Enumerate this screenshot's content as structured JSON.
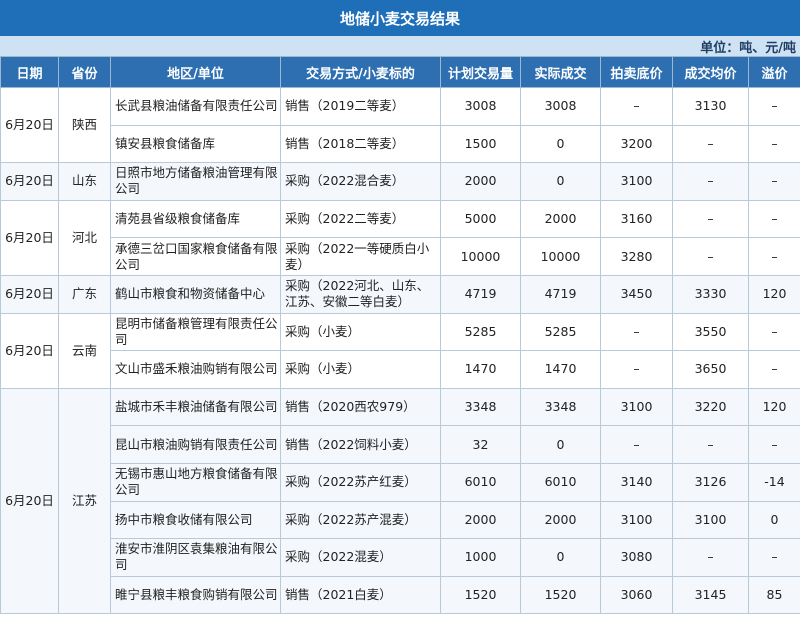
{
  "title": "地储小麦交易结果",
  "unit": "单位：吨、元/吨",
  "headers": [
    "日期",
    "省份",
    "地区/单位",
    "交易方式/小麦标的",
    "计划交易量",
    "实际成交",
    "拍卖底价",
    "成交均价",
    "溢价"
  ],
  "groups": [
    {
      "date": "6月20日",
      "province": "陕西",
      "rows": [
        {
          "unit": "长武县粮油储备有限责任公司",
          "method": "销售（2019二等麦）",
          "plan": "3008",
          "actual": "3008",
          "floor": "–",
          "avg": "3130",
          "premium": "–"
        },
        {
          "unit": "镇安县粮食储备库",
          "method": "销售（2018二等麦）",
          "plan": "1500",
          "actual": "0",
          "floor": "3200",
          "avg": "–",
          "premium": "–"
        }
      ]
    },
    {
      "date": "6月20日",
      "province": "山东",
      "rows": [
        {
          "unit": "日照市地方储备粮油管理有限公司",
          "method": "采购（2022混合麦）",
          "plan": "2000",
          "actual": "0",
          "floor": "3100",
          "avg": "–",
          "premium": "–"
        }
      ]
    },
    {
      "date": "6月20日",
      "province": "河北",
      "rows": [
        {
          "unit": "清苑县省级粮食储备库",
          "method": "采购（2022二等麦）",
          "plan": "5000",
          "actual": "2000",
          "floor": "3160",
          "avg": "–",
          "premium": "–"
        },
        {
          "unit": "承德三岔口国家粮食储备有限公司",
          "method": "采购（2022一等硬质白小麦）",
          "plan": "10000",
          "actual": "10000",
          "floor": "3280",
          "avg": "–",
          "premium": "–"
        }
      ]
    },
    {
      "date": "6月20日",
      "province": "广东",
      "rows": [
        {
          "unit": "鹤山市粮食和物资储备中心",
          "method": "采购（2022河北、山东、江苏、安徽二等白麦）",
          "plan": "4719",
          "actual": "4719",
          "floor": "3450",
          "avg": "3330",
          "premium": "120"
        }
      ]
    },
    {
      "date": "6月20日",
      "province": "云南",
      "rows": [
        {
          "unit": "昆明市储备粮管理有限责任公司",
          "method": "采购（小麦）",
          "plan": "5285",
          "actual": "5285",
          "floor": "–",
          "avg": "3550",
          "premium": "–"
        },
        {
          "unit": "文山市盛禾粮油购销有限公司",
          "method": "采购（小麦）",
          "plan": "1470",
          "actual": "1470",
          "floor": "–",
          "avg": "3650",
          "premium": "–"
        }
      ]
    },
    {
      "date": "6月20日",
      "province": "江苏",
      "rows": [
        {
          "unit": "盐城市禾丰粮油储备有限公司",
          "method": "销售（2020西农979）",
          "plan": "3348",
          "actual": "3348",
          "floor": "3100",
          "avg": "3220",
          "premium": "120"
        },
        {
          "unit": "昆山市粮油购销有限责任公司",
          "method": "销售（2022饲料小麦）",
          "plan": "32",
          "actual": "0",
          "floor": "–",
          "avg": "–",
          "premium": "–"
        },
        {
          "unit": "无锡市惠山地方粮食储备有限公司",
          "method": "采购（2022苏产红麦）",
          "plan": "6010",
          "actual": "6010",
          "floor": "3140",
          "avg": "3126",
          "premium": "-14"
        },
        {
          "unit": "扬中市粮食收储有限公司",
          "method": "采购（2022苏产混麦）",
          "plan": "2000",
          "actual": "2000",
          "floor": "3100",
          "avg": "3100",
          "premium": "0"
        },
        {
          "unit": "淮安市淮阴区袁集粮油有限公司",
          "method": "采购（2022混麦）",
          "plan": "1000",
          "actual": "0",
          "floor": "3080",
          "avg": "–",
          "premium": "–"
        },
        {
          "unit": "睢宁县粮丰粮食购销有限公司",
          "method": "销售（2021白麦）",
          "plan": "1520",
          "actual": "1520",
          "floor": "3060",
          "avg": "3145",
          "premium": "85"
        }
      ]
    }
  ]
}
